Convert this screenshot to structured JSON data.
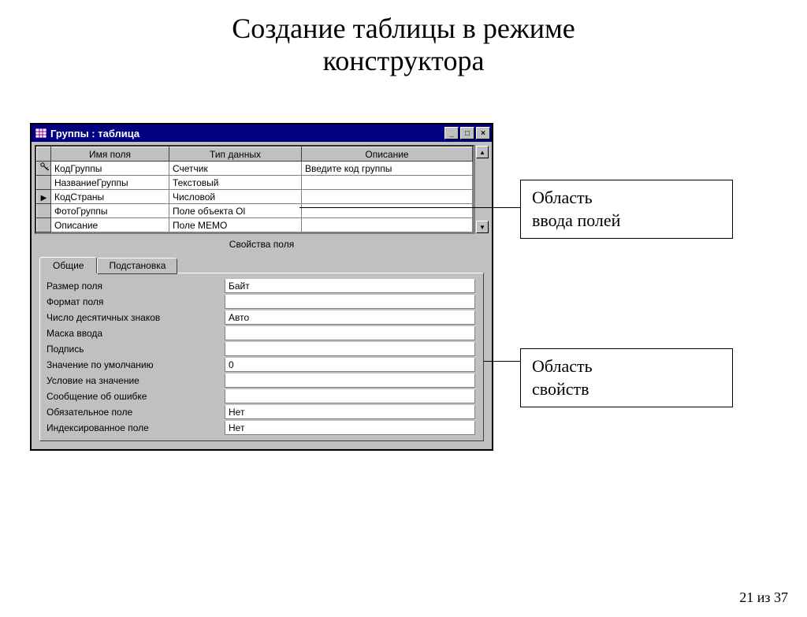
{
  "page_title_line1": "Создание таблицы в режиме",
  "page_title_line2": "конструктора",
  "window": {
    "title": "Группы : таблица",
    "columns": {
      "name": "Имя поля",
      "type": "Тип данных",
      "desc": "Описание"
    },
    "rows": [
      {
        "marker": "key",
        "name": "КодГруппы",
        "type": "Счетчик",
        "desc": "Введите код группы"
      },
      {
        "marker": "",
        "name": "НазваниеГруппы",
        "type": "Текстовый",
        "desc": ""
      },
      {
        "marker": "current",
        "name": "КодСтраны",
        "type": "Числовой",
        "desc": ""
      },
      {
        "marker": "",
        "name": "ФотоГруппы",
        "type": "Поле объекта Ol",
        "desc": ""
      },
      {
        "marker": "",
        "name": "Описание",
        "type": "Поле MEMO",
        "desc": ""
      }
    ],
    "props_section_title": "Свойства поля",
    "tabs": {
      "general": "Общие",
      "lookup": "Подстановка"
    },
    "properties": [
      {
        "label": "Размер поля",
        "value": "Байт"
      },
      {
        "label": "Формат поля",
        "value": ""
      },
      {
        "label": "Число десятичных знаков",
        "value": "Авто"
      },
      {
        "label": "Маска ввода",
        "value": ""
      },
      {
        "label": "Подпись",
        "value": ""
      },
      {
        "label": "Значение по умолчанию",
        "value": "0"
      },
      {
        "label": "Условие на значение",
        "value": ""
      },
      {
        "label": "Сообщение об ошибке",
        "value": ""
      },
      {
        "label": "Обязательное поле",
        "value": "Нет"
      },
      {
        "label": "Индексированное поле",
        "value": "Нет"
      }
    ]
  },
  "callouts": {
    "fields_area_l1": "Область",
    "fields_area_l2": "ввода полей",
    "props_area_l1": "Область",
    "props_area_l2": "свойств"
  },
  "page_number": "21 из 37"
}
